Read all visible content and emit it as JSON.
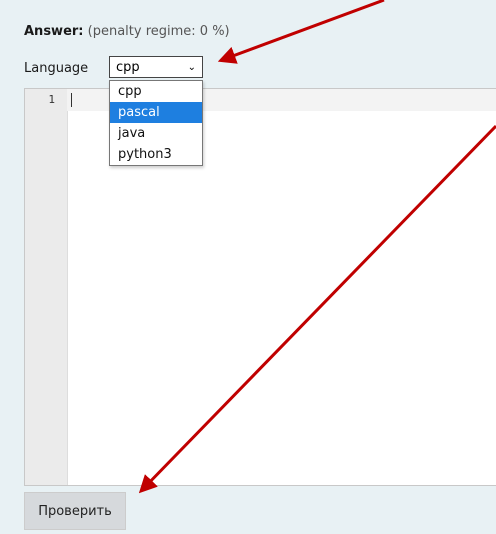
{
  "answer": {
    "label": "Answer:",
    "penalty": "(penalty regime: 0 %)"
  },
  "language": {
    "label": "Language",
    "selected": "cpp",
    "options": [
      "cpp",
      "pascal",
      "java",
      "python3"
    ],
    "highlighted": "pascal"
  },
  "editor": {
    "line_number": "1"
  },
  "check_button": {
    "label": "Проверить"
  },
  "colors": {
    "arrow": "#c00000",
    "highlight": "#1e7fe0"
  }
}
